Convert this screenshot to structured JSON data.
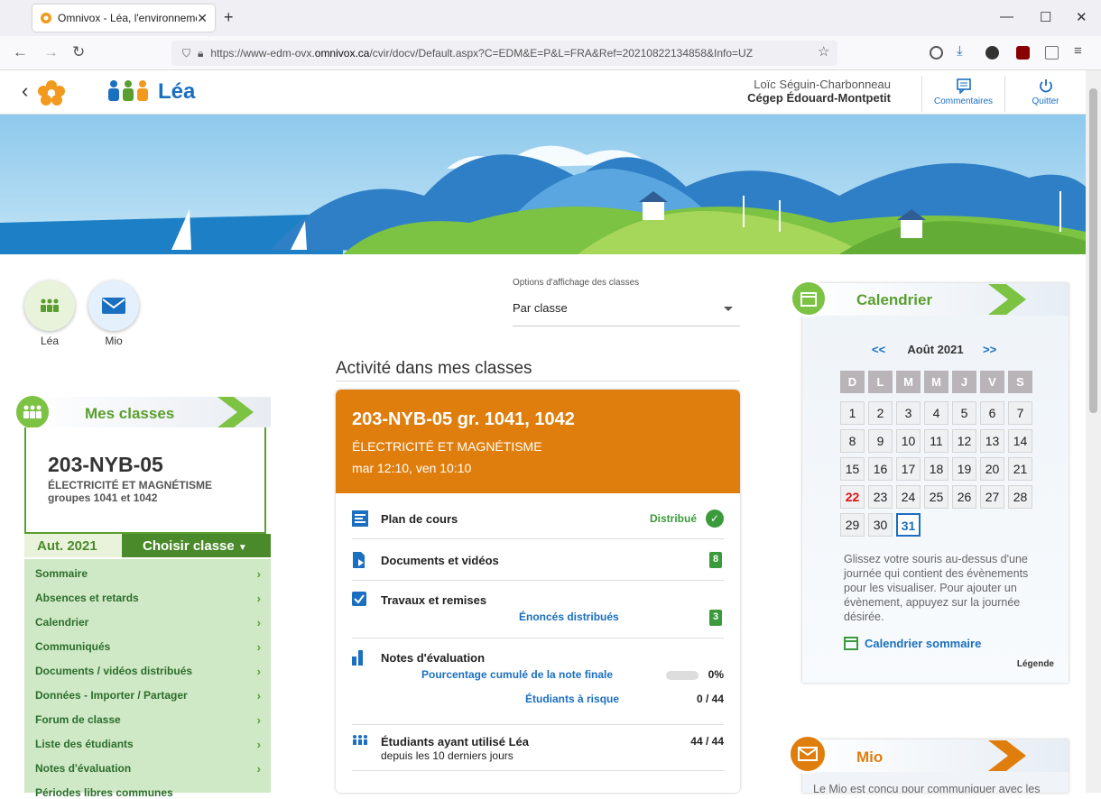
{
  "browser": {
    "tab_title": "Omnivox - Léa, l'environnemen",
    "url_prefix": "https://www-edm-ovx.",
    "url_domain": "omnivox.ca",
    "url_suffix": "/cvir/docv/Default.aspx?C=EDM&E=P&L=FRA&Ref=20210822134858&Info=UZ"
  },
  "header": {
    "app_name": "Léa",
    "user_name": "Loïc Séguin-Charbonneau",
    "school": "Cégep Édouard-Montpetit",
    "comments_label": "Commentaires",
    "quit_label": "Quitter"
  },
  "shortcuts": {
    "lea": "Léa",
    "mio": "Mio"
  },
  "display_options": {
    "label": "Options d'affichage des classes",
    "value": "Par classe"
  },
  "activity_title": "Activité dans mes classes",
  "my_classes": {
    "title": "Mes classes",
    "code": "203-NYB-05",
    "name": "ÉLECTRICITÉ ET MAGNÉTISME",
    "groups": "groupes 1041 et 1042",
    "semester": "Aut. 2021",
    "choose": "Choisir classe",
    "menu": [
      "Sommaire",
      "Absences et retards",
      "Calendrier",
      "Communiqués",
      "Documents / vidéos distribués",
      "Données - Importer / Partager",
      "Forum de classe",
      "Liste des étudiants",
      "Notes d'évaluation",
      "Périodes libres communes"
    ]
  },
  "class_card": {
    "title": "203-NYB-05 gr. 1041, 1042",
    "subject": "ÉLECTRICITÉ ET MAGNÉTISME",
    "schedule": "mar 12:10, ven 10:10",
    "plan_label": "Plan de cours",
    "plan_status": "Distribué",
    "docs_label": "Documents et vidéos",
    "docs_count": "8",
    "works_label": "Travaux et remises",
    "works_sub": "Énoncés distribués",
    "works_count": "3",
    "grades_label": "Notes d'évaluation",
    "grades_pct_label": "Pourcentage cumulé de la note finale",
    "grades_pct": "0%",
    "grades_pct_fraction": 0,
    "risk_label": "Étudiants à risque",
    "risk_value": "0 / 44",
    "users_label": "Étudiants ayant utilisé Léa",
    "users_sub": "depuis les 10 derniers jours",
    "users_value": "44 / 44"
  },
  "calendar": {
    "title": "Calendrier",
    "prev": "<<",
    "next": ">>",
    "month": "Août 2021",
    "day_headers": [
      "D",
      "L",
      "M",
      "M",
      "J",
      "V",
      "S"
    ],
    "weeks": [
      [
        "1",
        "2",
        "3",
        "4",
        "5",
        "6",
        "7"
      ],
      [
        "8",
        "9",
        "10",
        "11",
        "12",
        "13",
        "14"
      ],
      [
        "15",
        "16",
        "17",
        "18",
        "19",
        "20",
        "21"
      ],
      [
        "22",
        "23",
        "24",
        "25",
        "26",
        "27",
        "28"
      ],
      [
        "29",
        "30",
        "31"
      ]
    ],
    "today": "22",
    "selected": "31",
    "hint": "Glissez votre souris au-dessus d'une journée qui contient des évènements pour les visualiser. Pour ajouter un évènement, appuyez sur la journée désirée.",
    "summary_link": "Calendrier sommaire",
    "legend": "Légende"
  },
  "mio": {
    "title": "Mio",
    "text": "Le Mio est conçu pour communiquer avec les"
  },
  "colors": {
    "green": "#5a9e2f",
    "orange": "#e07e0d",
    "blue": "#1a6fc0"
  }
}
